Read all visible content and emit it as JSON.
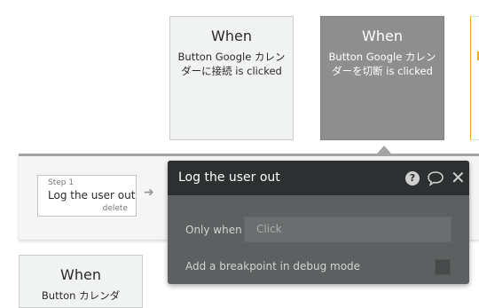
{
  "events": [
    {
      "when": "When",
      "description": "Button Google カレンダーに接続 is clicked"
    },
    {
      "when": "When",
      "description": "Button Google カレンダーを切断 is clicked"
    },
    {
      "when": "When",
      "description": "Button カレンダ"
    }
  ],
  "step": {
    "label": "Step 1",
    "name": "Log the user out",
    "delete": "delete"
  },
  "panel": {
    "title": "Log the user out",
    "only_when_label": "Only when",
    "only_when_placeholder": "Click",
    "breakpoint_label": "Add a breakpoint in debug mode"
  },
  "icons": {
    "help": "help-icon",
    "comment": "comment-icon",
    "close": "close-icon",
    "arrow": "arrow-right-icon"
  },
  "colors": {
    "selected_event": "#8e8e8e",
    "panel_header": "#2c3030",
    "panel_body": "#5d6060",
    "accent": "#f5a623"
  }
}
